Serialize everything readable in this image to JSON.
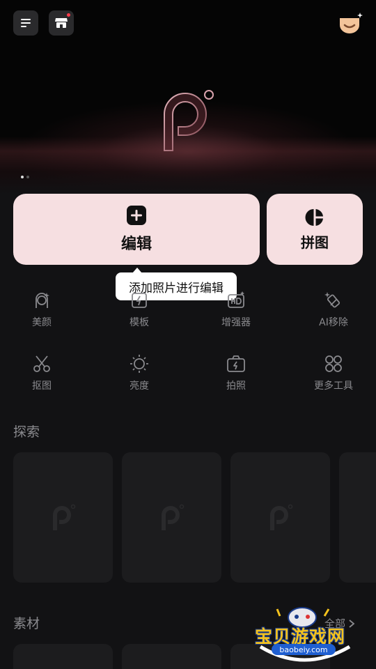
{
  "header": {
    "menu_icon": "menu-lines-icon",
    "store_icon": "store-icon",
    "vip_icon": "vip-heart-icon"
  },
  "hero": {
    "slides": 2,
    "active_slide": 1
  },
  "actions": {
    "edit_label": "编辑",
    "collage_label": "拼图",
    "tooltip": "添加照片进行编辑"
  },
  "tools": [
    {
      "label": "美颜",
      "icon": "face-icon"
    },
    {
      "label": "模板",
      "icon": "template-icon"
    },
    {
      "label": "增强器",
      "icon": "hd-enhance-icon"
    },
    {
      "label": "AI移除",
      "icon": "eraser-icon"
    },
    {
      "label": "抠图",
      "icon": "scissors-icon"
    },
    {
      "label": "亮度",
      "icon": "brightness-icon"
    },
    {
      "label": "拍照",
      "icon": "camera-icon"
    },
    {
      "label": "更多工具",
      "icon": "grid-icon"
    }
  ],
  "sections": {
    "explore": "探索",
    "materials": "素材",
    "all": "全部"
  },
  "watermark": {
    "name": "宝贝游戏网",
    "url": "baobeiy.com"
  },
  "colors": {
    "card": "#f6dfe1",
    "background": "#121214",
    "tile": "#1c1c1e"
  }
}
